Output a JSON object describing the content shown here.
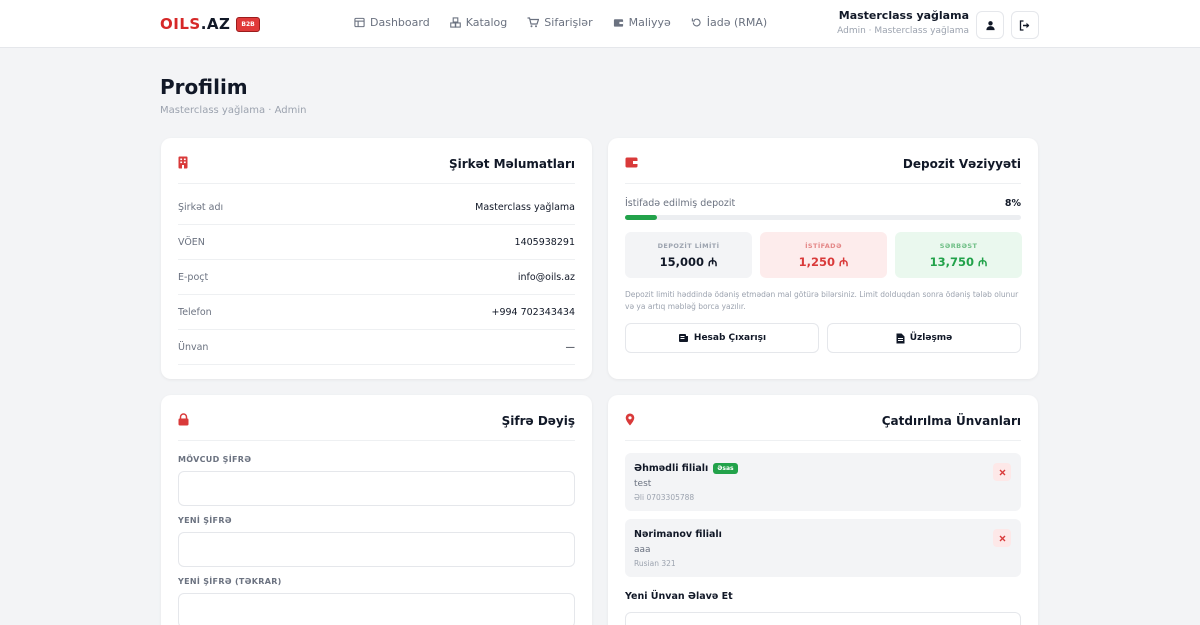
{
  "header": {
    "logo_part1": "OILS",
    "logo_part2": ".AZ",
    "logo_badge": "B2B",
    "nav": [
      {
        "label": "Dashboard",
        "icon": "dashboard-icon"
      },
      {
        "label": "Katalog",
        "icon": "catalog-icon"
      },
      {
        "label": "Sifarişlər",
        "icon": "cart-icon"
      },
      {
        "label": "Maliyyə",
        "icon": "wallet-icon"
      },
      {
        "label": "İadə (RMA)",
        "icon": "return-icon"
      }
    ],
    "user_name": "Masterclass yağlama",
    "user_role": "Admin · Masterclass yağlama"
  },
  "page": {
    "title": "Profilim",
    "subtitle": "Masterclass yağlama · Admin"
  },
  "company": {
    "title": "Şirkət Məlumatları",
    "rows": [
      {
        "label": "Şirkət adı",
        "value": "Masterclass yağlama"
      },
      {
        "label": "VÖEN",
        "value": "1405938291"
      },
      {
        "label": "E-poçt",
        "value": "info@oils.az"
      },
      {
        "label": "Telefon",
        "value": "+994 702343434"
      },
      {
        "label": "Ünvan",
        "value": "—"
      }
    ]
  },
  "deposit": {
    "title": "Depozit Vəziyyəti",
    "used_label": "İstifadə edilmiş depozit",
    "used_percent_text": "8%",
    "used_fraction": 0.08,
    "stats": [
      {
        "label": "DEPOZİT LİMİTİ",
        "value": "15,000 ₼"
      },
      {
        "label": "İSTİFADƏ",
        "value": "1,250 ₼"
      },
      {
        "label": "SƏRBƏST",
        "value": "13,750 ₼"
      }
    ],
    "note": "Depozit limiti həddində ödəniş etmədən mal götürə bilərsiniz. Limit dolduqdan sonra ödəniş tələb olunur və ya artıq məbləğ borca yazılır.",
    "btn_statement": "Hesab Çıxarışı",
    "btn_reconcile": "Üzləşmə"
  },
  "password": {
    "title": "Şifrə Dəyiş",
    "current_label": "MÖVCUD ŞİFRƏ",
    "new_label": "YENİ ŞİFRƏ",
    "repeat_label": "YENİ ŞİFRƏ (TƏKRAR)"
  },
  "addresses": {
    "title": "Çatdırılma Ünvanları",
    "items": [
      {
        "name": "Əhmədli filialı",
        "badge": "Əsas",
        "line": "test",
        "phone": "Əli 0703305788"
      },
      {
        "name": "Nərimanov filialı",
        "badge": "",
        "line": "aaa",
        "phone": "Rusian 321"
      }
    ],
    "new_title": "Yeni Ünvan Əlavə Et"
  },
  "colors": {
    "brand_red": "#d62828",
    "success_green": "#22a24a",
    "danger_red": "#d93a3a"
  }
}
